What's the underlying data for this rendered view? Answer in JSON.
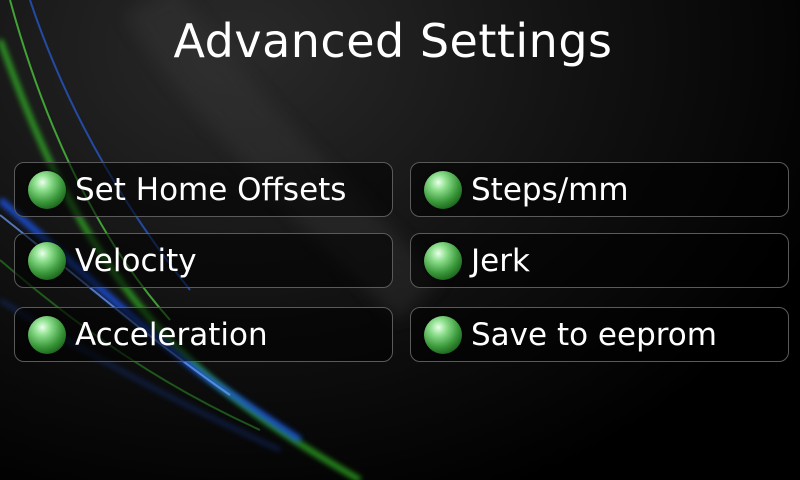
{
  "screen": {
    "title": "Advanced Settings"
  },
  "menu": {
    "items": [
      {
        "label": "Set Home Offsets",
        "icon": "green-orb-icon"
      },
      {
        "label": "Steps/mm",
        "icon": "green-orb-icon"
      },
      {
        "label": "Velocity",
        "icon": "green-orb-icon"
      },
      {
        "label": "Jerk",
        "icon": "green-orb-icon"
      },
      {
        "label": "Acceleration",
        "icon": "green-orb-icon"
      },
      {
        "label": "Save to eeprom",
        "icon": "green-orb-icon"
      }
    ]
  },
  "colors": {
    "background": "#000000",
    "text": "#ffffff",
    "button_border": "#5a5a5a",
    "orb": "#3c9a3c",
    "streak_green": "#39d42a",
    "streak_blue": "#1e5cff"
  }
}
